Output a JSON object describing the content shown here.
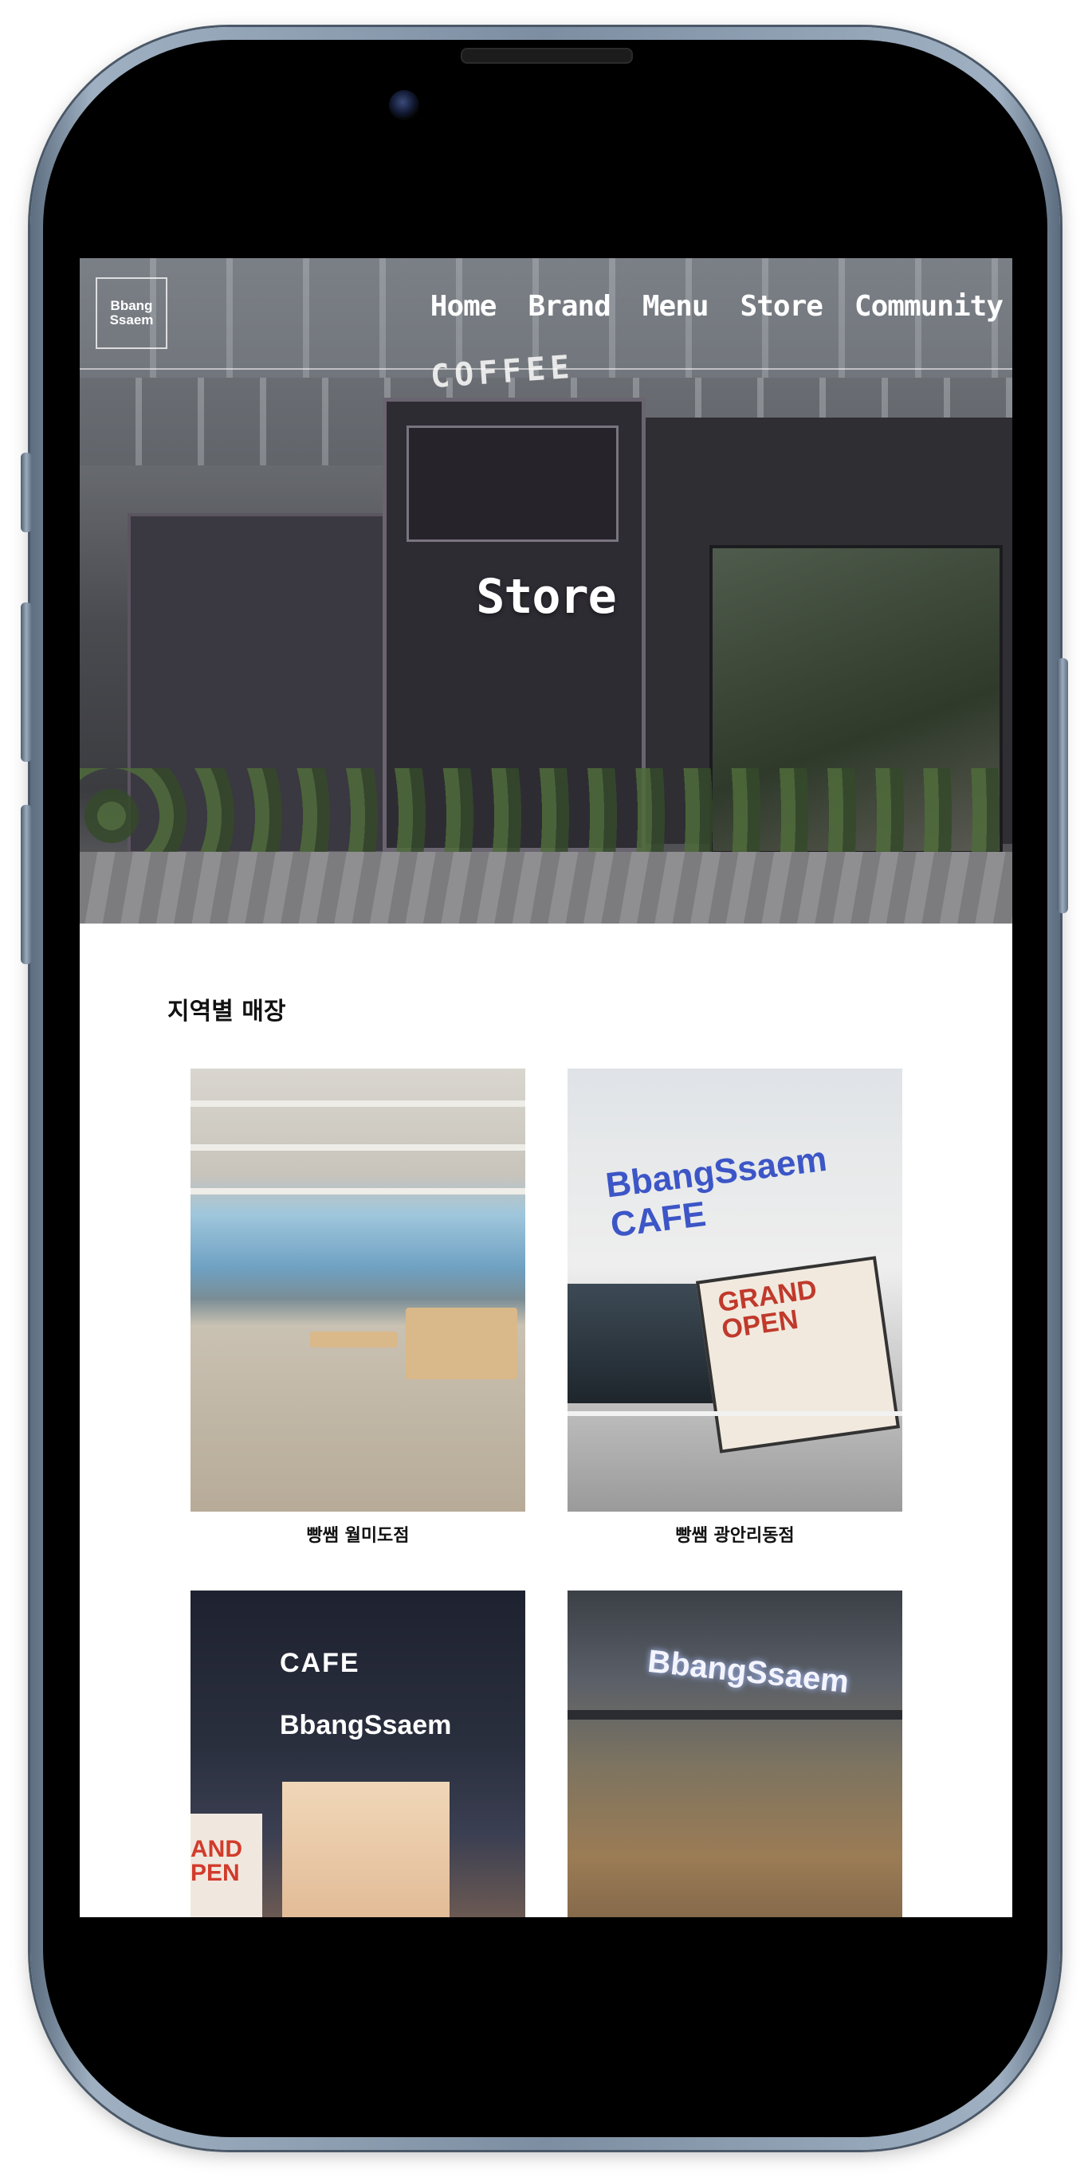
{
  "nav": {
    "logo_line1": "Bbang",
    "logo_line2": "Ssaem",
    "items": [
      "Home",
      "Brand",
      "Menu",
      "Store",
      "Community"
    ]
  },
  "hero": {
    "title": "Store",
    "sign_text": "COFFEE"
  },
  "section": {
    "title": "지역별 매장"
  },
  "stores": [
    {
      "name": "빵쌤 월미도점"
    },
    {
      "name": "빵쌤 광안리동점"
    },
    {
      "name": ""
    },
    {
      "name": ""
    }
  ],
  "photo_text": {
    "store2_brand": "BbangSsaem CAFE",
    "store2_banner_1": "GRAND",
    "store2_banner_2": "OPEN",
    "store3_cafe": "CAFE",
    "store3_brand": "BbangSsaem",
    "store3_promo_1": "AND",
    "store3_promo_2": "PEN",
    "store4_brand": "BbangSsaem"
  }
}
